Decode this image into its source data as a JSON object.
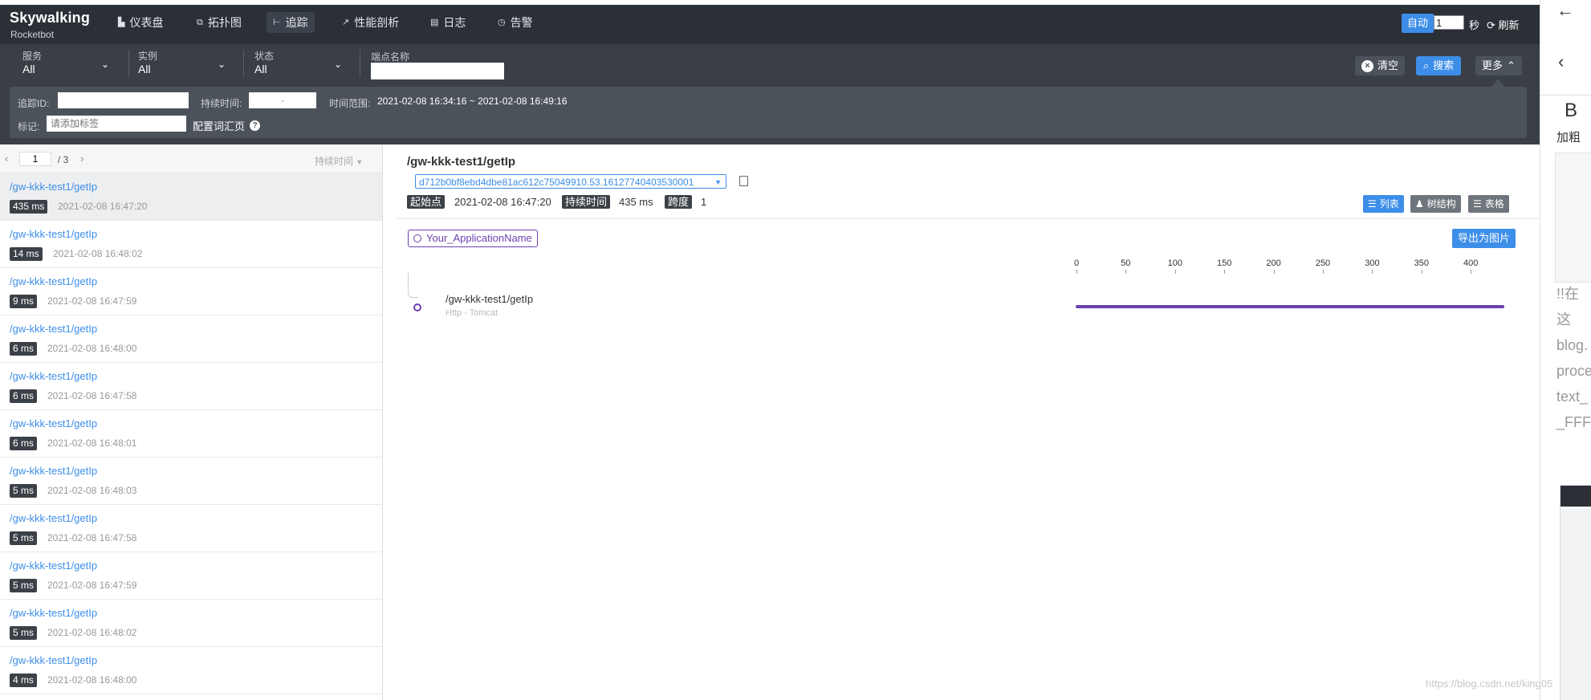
{
  "brand": {
    "logo": "Skywalking",
    "sub": "Rocketbot"
  },
  "nav": [
    {
      "label": "仪表盘",
      "icon": "dashboard-icon"
    },
    {
      "label": "拓扑图",
      "icon": "topology-icon"
    },
    {
      "label": "追踪",
      "icon": "trace-icon",
      "active": true
    },
    {
      "label": "性能剖析",
      "icon": "profile-icon"
    },
    {
      "label": "日志",
      "icon": "log-icon"
    },
    {
      "label": "告警",
      "icon": "alarm-icon"
    }
  ],
  "refresh_control": {
    "auto_label": "自动",
    "interval": "1",
    "seconds_label": "秒",
    "refresh_label": "刷新"
  },
  "filters": {
    "service": {
      "label": "服务",
      "value": "All"
    },
    "instance": {
      "label": "实例",
      "value": "All"
    },
    "status": {
      "label": "状态",
      "value": "All"
    },
    "endpoint": {
      "label": "端点名称",
      "value": ""
    },
    "clear_label": "清空",
    "search_label": "搜索",
    "more_label": "更多"
  },
  "more_panel": {
    "trace_id_label": "追踪ID:",
    "duration_label": "持续时间:",
    "duration_sep": "-",
    "time_range_label": "时间范围:",
    "time_range_value": "2021-02-08 16:34:16 ~ 2021-02-08 16:49:16",
    "tag_label": "标记:",
    "tag_placeholder": "请添加标签",
    "config_label": "配置词汇页"
  },
  "pager": {
    "current": "1",
    "total": "/ 3",
    "sort_label": "持续时间"
  },
  "traces": [
    {
      "endpoint": "/gw-kkk-test1/getIp",
      "duration": "435 ms",
      "time": "2021-02-08 16:47:20",
      "selected": true
    },
    {
      "endpoint": "/gw-kkk-test1/getIp",
      "duration": "14 ms",
      "time": "2021-02-08 16:48:02"
    },
    {
      "endpoint": "/gw-kkk-test1/getIp",
      "duration": "9 ms",
      "time": "2021-02-08 16:47:59"
    },
    {
      "endpoint": "/gw-kkk-test1/getIp",
      "duration": "6 ms",
      "time": "2021-02-08 16:48:00"
    },
    {
      "endpoint": "/gw-kkk-test1/getIp",
      "duration": "6 ms",
      "time": "2021-02-08 16:47:58"
    },
    {
      "endpoint": "/gw-kkk-test1/getIp",
      "duration": "6 ms",
      "time": "2021-02-08 16:48:01"
    },
    {
      "endpoint": "/gw-kkk-test1/getIp",
      "duration": "5 ms",
      "time": "2021-02-08 16:48:03"
    },
    {
      "endpoint": "/gw-kkk-test1/getIp",
      "duration": "5 ms",
      "time": "2021-02-08 16:47:58"
    },
    {
      "endpoint": "/gw-kkk-test1/getIp",
      "duration": "5 ms",
      "time": "2021-02-08 16:47:59"
    },
    {
      "endpoint": "/gw-kkk-test1/getIp",
      "duration": "5 ms",
      "time": "2021-02-08 16:48:02"
    },
    {
      "endpoint": "/gw-kkk-test1/getIp",
      "duration": "4 ms",
      "time": "2021-02-08 16:48:00"
    }
  ],
  "detail": {
    "title": "/gw-kkk-test1/getIp",
    "trace_id": "d712b0bf8ebd4dbe81ac612c75049910.53.16127740403530001",
    "start_label": "起始点",
    "start_value": "2021-02-08 16:47:20",
    "duration_label": "持续时间",
    "duration_value": "435 ms",
    "span_label": "跨度",
    "span_value": "1",
    "view_list": "列表",
    "view_tree": "树结构",
    "view_table": "表格",
    "app_name": "Your_ApplicationName",
    "export_label": "导出为图片",
    "span": {
      "name": "/gw-kkk-test1/getIp",
      "component": "Http - Tomcat",
      "duration_ms": 435
    }
  },
  "timeline_ticks": [
    "0",
    "50",
    "100",
    "150",
    "200",
    "250",
    "300",
    "350",
    "400"
  ],
  "right_overlay": {
    "bold_label": "加粗",
    "bold_letter": "B",
    "snippet": [
      "!!在这",
      "blog.",
      "proce",
      "text_",
      "_FFF"
    ]
  },
  "watermark": "https://blog.csdn.net/king05"
}
